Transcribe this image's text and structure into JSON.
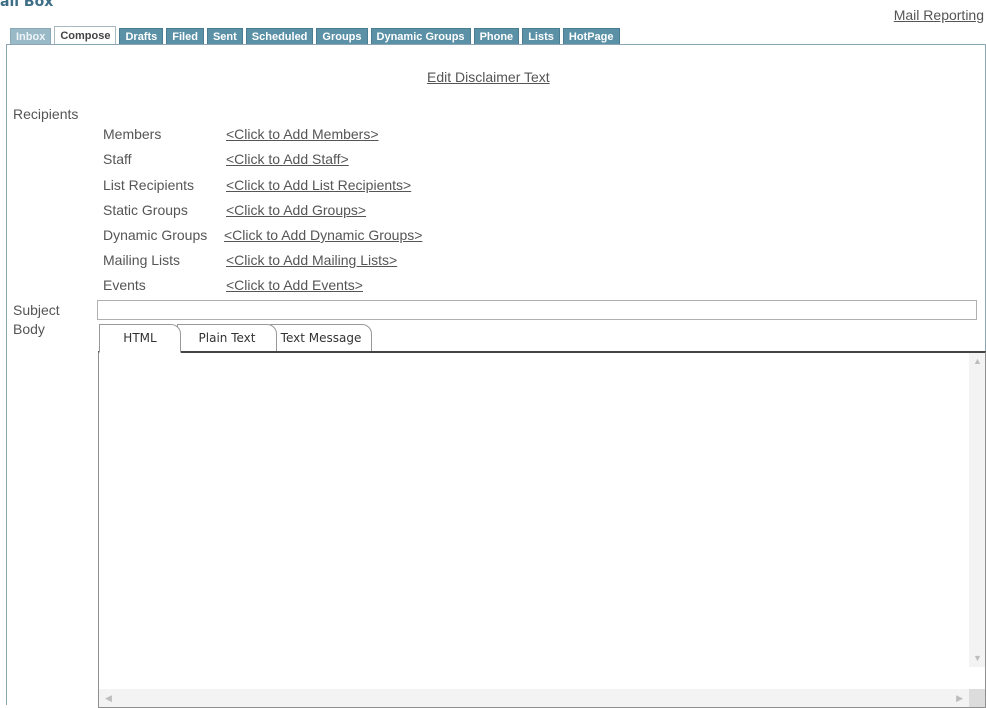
{
  "brand": {
    "partial_text": "ail Box"
  },
  "header": {
    "mail_reporting": "Mail Reporting"
  },
  "tabs": [
    {
      "label": "Inbox"
    },
    {
      "label": "Compose"
    },
    {
      "label": "Drafts"
    },
    {
      "label": "Filed"
    },
    {
      "label": "Sent"
    },
    {
      "label": "Scheduled"
    },
    {
      "label": "Groups"
    },
    {
      "label": "Dynamic Groups"
    },
    {
      "label": "Phone"
    },
    {
      "label": "Lists"
    },
    {
      "label": "HotPage"
    }
  ],
  "active_tab": "Compose",
  "compose": {
    "edit_disclaimer": "Edit Disclaimer Text",
    "recipients_label": "Recipients",
    "recipients": [
      {
        "label": "Members",
        "link": "<Click to Add Members>"
      },
      {
        "label": "Staff",
        "link": "<Click to Add Staff>"
      },
      {
        "label": "List Recipients",
        "link": "<Click to Add List Recipients>"
      },
      {
        "label": "Static Groups",
        "link": "<Click to Add Groups>"
      },
      {
        "label": "Dynamic Groups",
        "link": "<Click to Add Dynamic Groups>"
      },
      {
        "label": "Mailing Lists",
        "link": "<Click to Add Mailing Lists>"
      },
      {
        "label": "Events",
        "link": "<Click to Add Events>"
      }
    ],
    "subject_label": "Subject",
    "subject_value": "",
    "body_label": "Body",
    "editor_tabs": [
      {
        "label": "HTML"
      },
      {
        "label": "Plain Text"
      },
      {
        "label": "Text Message"
      }
    ],
    "active_editor_tab": "HTML",
    "body_value": ""
  },
  "colors": {
    "tab_bg": "#5b91a7",
    "tab_inbox_bg": "#9ab9c7",
    "panel_border": "#8aa6b4",
    "text": "#555555"
  },
  "icons": {
    "scroll_up": "scroll-up-arrow-icon",
    "scroll_down": "scroll-down-arrow-icon",
    "scroll_left": "scroll-left-arrow-icon",
    "scroll_right": "scroll-right-arrow-icon"
  }
}
